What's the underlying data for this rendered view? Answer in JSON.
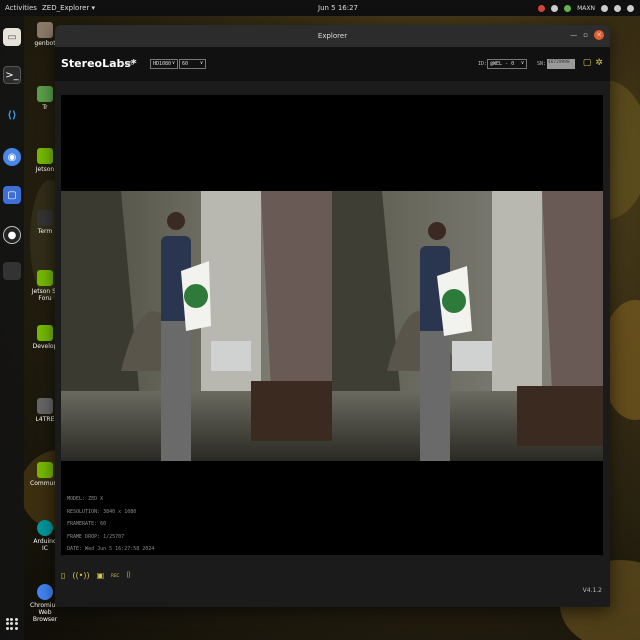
{
  "topbar": {
    "activities": "Activities",
    "app_menu": "ZED_Explorer ▾",
    "clock": "Jun 5  16:27",
    "maxn": "MAXN"
  },
  "desktop_icons": [
    {
      "label": "genbot",
      "color": "#8a7a6a"
    },
    {
      "label": "Tr",
      "color": "#5aa04a"
    },
    {
      "label": "Jetson",
      "color": "#76b900"
    },
    {
      "label": "Term",
      "color": "#333333"
    },
    {
      "label": "Jetson St Foru",
      "color": "#76b900"
    },
    {
      "label": "Develop",
      "color": "#76b900"
    },
    {
      "label": "L4TRE",
      "color": "#666666"
    },
    {
      "label": "Communit",
      "color": "#76b900"
    },
    {
      "label": "Arduino IC",
      "color": "#00979d"
    },
    {
      "label": "Chromium Web Browser",
      "color": "#4285f4"
    }
  ],
  "window": {
    "title": "Explorer"
  },
  "app": {
    "logo": "StereoLabs*",
    "live": "LIVE",
    "resolution_select": "HD1080",
    "fps_select": "60",
    "id_label": "ID:",
    "id_select": "@WEL - 0",
    "sn_label": "SN:",
    "sn_value": "46729998"
  },
  "info": {
    "model": "MODEL: ZED X",
    "resolution": "RESOLUTION: 3840 x 1080",
    "framerate": "FRAMERATE: 60",
    "frame_drop": "FRAME DROP: 1/25707",
    "date": "DATE: Wed Jun 5 16:27:58 2024"
  },
  "footer": {
    "rec_label": "REC",
    "version": "V4.1.2"
  },
  "colors": {
    "accent": "#d8c64a",
    "window_bg": "#1b1b1b"
  }
}
